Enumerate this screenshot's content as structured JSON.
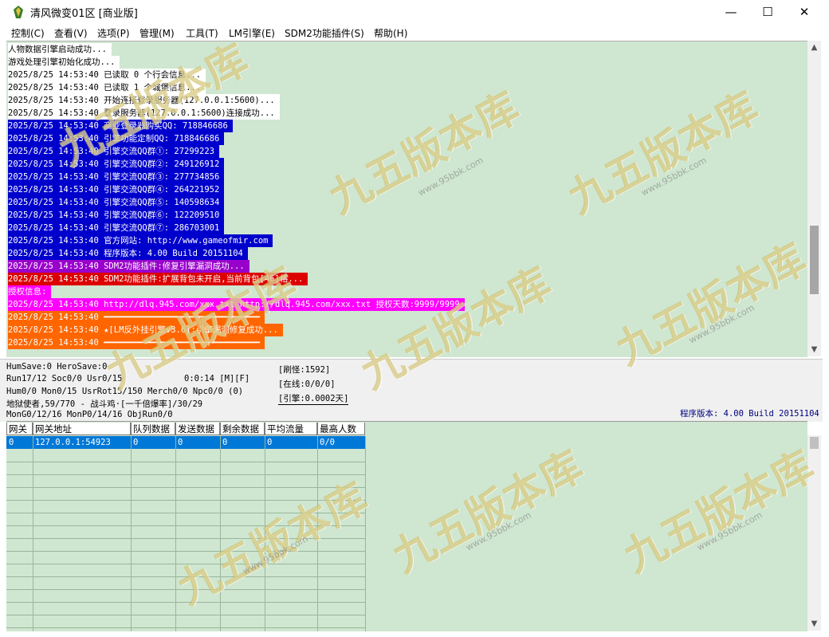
{
  "window": {
    "title": "清风微变01区 [商业版]",
    "minimize": "—",
    "maximize": "☐",
    "close": "✕"
  },
  "menu": [
    "控制(C)",
    "查看(V)",
    "选项(P)",
    "管理(M)",
    "工具(T)",
    "LM引擎(E)",
    "SDM2功能插件(S)",
    "帮助(H)"
  ],
  "log": [
    {
      "text": "人物数据引擎启动成功...",
      "bg": "#ffffff",
      "fg": "#000000"
    },
    {
      "text": "游戏处理引擎初始化成功...",
      "bg": "#ffffff",
      "fg": "#000000"
    },
    {
      "text": "2025/8/25 14:53:40 已读取 0 个行会信息...",
      "bg": "#ffffff",
      "fg": "#000000"
    },
    {
      "text": "2025/8/25 14:53:40 已读取 1 个城堡信息...",
      "bg": "#ffffff",
      "fg": "#000000"
    },
    {
      "text": "2025/8/25 14:53:40 开始连接登录服务器(127.0.0.1:5600)...",
      "bg": "#ffffff",
      "fg": "#000000"
    },
    {
      "text": "2025/8/25 14:53:40 登录服务器(127.0.0.1:5600)连接成功...",
      "bg": "#ffffff",
      "fg": "#000000"
    },
    {
      "text": "2025/8/25 14:53:40 商业登录器购买QQ: 718846686",
      "bg": "#0000cc",
      "fg": "#ffffff"
    },
    {
      "text": "2025/8/25 14:53:40 引擎功能定制QQ: 718846686",
      "bg": "#0000cc",
      "fg": "#ffffff"
    },
    {
      "text": "2025/8/25 14:53:40 引擎交流QQ群①: 27299223",
      "bg": "#0000cc",
      "fg": "#ffffff"
    },
    {
      "text": "2025/8/25 14:53:40 引擎交流QQ群②: 249126912",
      "bg": "#0000cc",
      "fg": "#ffffff"
    },
    {
      "text": "2025/8/25 14:53:40 引擎交流QQ群③: 277734856",
      "bg": "#0000cc",
      "fg": "#ffffff"
    },
    {
      "text": "2025/8/25 14:53:40 引擎交流QQ群④: 264221952",
      "bg": "#0000cc",
      "fg": "#ffffff"
    },
    {
      "text": "2025/8/25 14:53:40 引擎交流QQ群⑤: 140598634",
      "bg": "#0000cc",
      "fg": "#ffffff"
    },
    {
      "text": "2025/8/25 14:53:40 引擎交流QQ群⑥: 122209510",
      "bg": "#0000cc",
      "fg": "#ffffff"
    },
    {
      "text": "2025/8/25 14:53:40 引擎交流QQ群⑦: 286703001",
      "bg": "#0000cc",
      "fg": "#ffffff"
    },
    {
      "text": "2025/8/25 14:53:40 官方网站: http://www.gameofmir.com",
      "bg": "#0000cc",
      "fg": "#ffffff"
    },
    {
      "text": "2025/8/25 14:53:40 程序版本: 4.00 Build 20151104",
      "bg": "#0000cc",
      "fg": "#ffffff"
    },
    {
      "text": "2025/8/25 14:53:40 SDM2功能插件:修复引擎漏洞成功...",
      "bg": "#9900cc",
      "fg": "#ffffff"
    },
    {
      "text": "2025/8/25 14:53:40 SDM2功能插件:扩展背包未开启,当前背包[46]格...",
      "bg": "#dd0000",
      "fg": "#ffffff"
    },
    {
      "text": "授权信息:",
      "bg": "#ff00ff",
      "fg": "#ffffff"
    },
    {
      "text": "2025/8/25 14:53:40 http://dlq.945.com/xxx.txt http://dlq.945.com/xxx.txt 授权天数:9999/9999",
      "bg": "#ff00ff",
      "fg": "#ffffff"
    },
    {
      "text": "2025/8/25 14:53:40 ━━━━━━━━━━━━━━━━━━━━━━━━━━━━━━━",
      "bg": "#ff6600",
      "fg": "#ffffff"
    },
    {
      "text": "2025/8/25 14:53:40 ★[LM反外挂引擎v3.6]:引擎漏洞修复成功...",
      "bg": "#ff6600",
      "fg": "#ffffff"
    },
    {
      "text": "2025/8/25 14:53:40 ━━━━━━━━━━━━━━━━━━━━━━━━━━━━━━━",
      "bg": "#ff6600",
      "fg": "#ffffff"
    }
  ],
  "status": {
    "line1": "HumSave:0 HeroSave:0",
    "line2a": "Run17/12 Soc0/0 Usr0/15",
    "line2b": "0:0:14 [M][F]",
    "line3": "Hum0/0 Mon0/15 UsrRot15/150 Merch0/0 Npc0/0 (0)",
    "line4": "地狱使者,59/770 - 战斗鸡·[一千倍爆率]/30/29",
    "line5": "MonG0/12/16 MonP0/14/16 ObjRun0/0",
    "refresh": "[刷怪:1592]",
    "online": "[在线:0/0/0]",
    "engine": "[引擎:0.0002天]",
    "version": "程序版本: 4.00 Build 20151104"
  },
  "grid": {
    "headers": [
      "网关",
      "网关地址",
      "队列数据",
      "发送数据",
      "剩余数据",
      "平均流量",
      "最高人数"
    ],
    "rows": [
      [
        "0",
        "127.0.0.1:54923",
        "0",
        "0",
        "0",
        "0",
        "0/0"
      ]
    ]
  },
  "watermark": {
    "text": "九五版本库",
    "sub": "www.95bbk.com"
  },
  "colors": {
    "log_bg": "#cfe6d0",
    "selected_row": "#0078d7",
    "version_text": "#000080"
  }
}
